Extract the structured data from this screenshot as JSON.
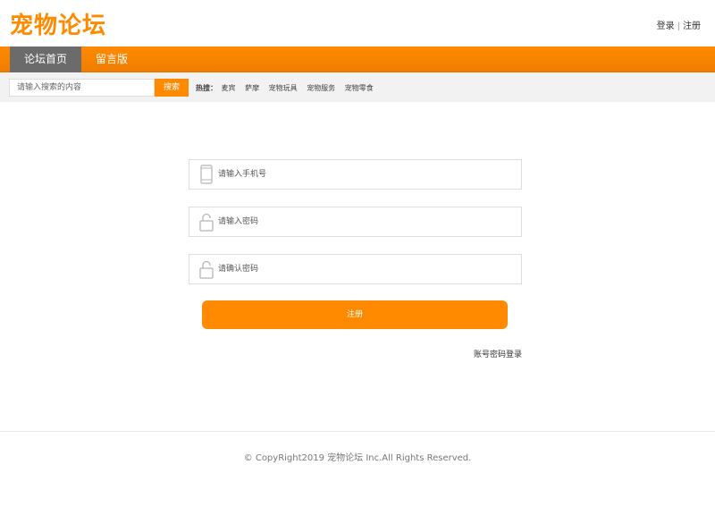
{
  "header": {
    "logo": "宠物论坛",
    "login_label": "登录",
    "separator": "|",
    "register_label": "注册"
  },
  "nav": {
    "items": [
      {
        "label": "论坛首页",
        "active": true
      },
      {
        "label": "留言版",
        "active": false
      }
    ]
  },
  "search": {
    "placeholder": "请输入搜索的内容",
    "button_label": "搜索",
    "hot_label": "热搜：",
    "hot_items": [
      "麦宾",
      "萨摩",
      "宠物玩具",
      "宠物服务",
      "宠物零食"
    ]
  },
  "form": {
    "phone_placeholder": "请输入手机号",
    "password_placeholder": "请输入密码",
    "confirm_placeholder": "请确认密码",
    "submit_label": "注册",
    "login_link": "账号密码登录"
  },
  "footer": {
    "copyright": "© CopyRight2019 宠物论坛 Inc.All Rights Reserved."
  },
  "colors": {
    "accent": "#ff8a00",
    "nav_active": "#6b6b6b",
    "searchbar_bg": "#f2f2f2"
  },
  "icons": [
    "mobile-phone-icon",
    "lock-icon",
    "lock-icon"
  ]
}
